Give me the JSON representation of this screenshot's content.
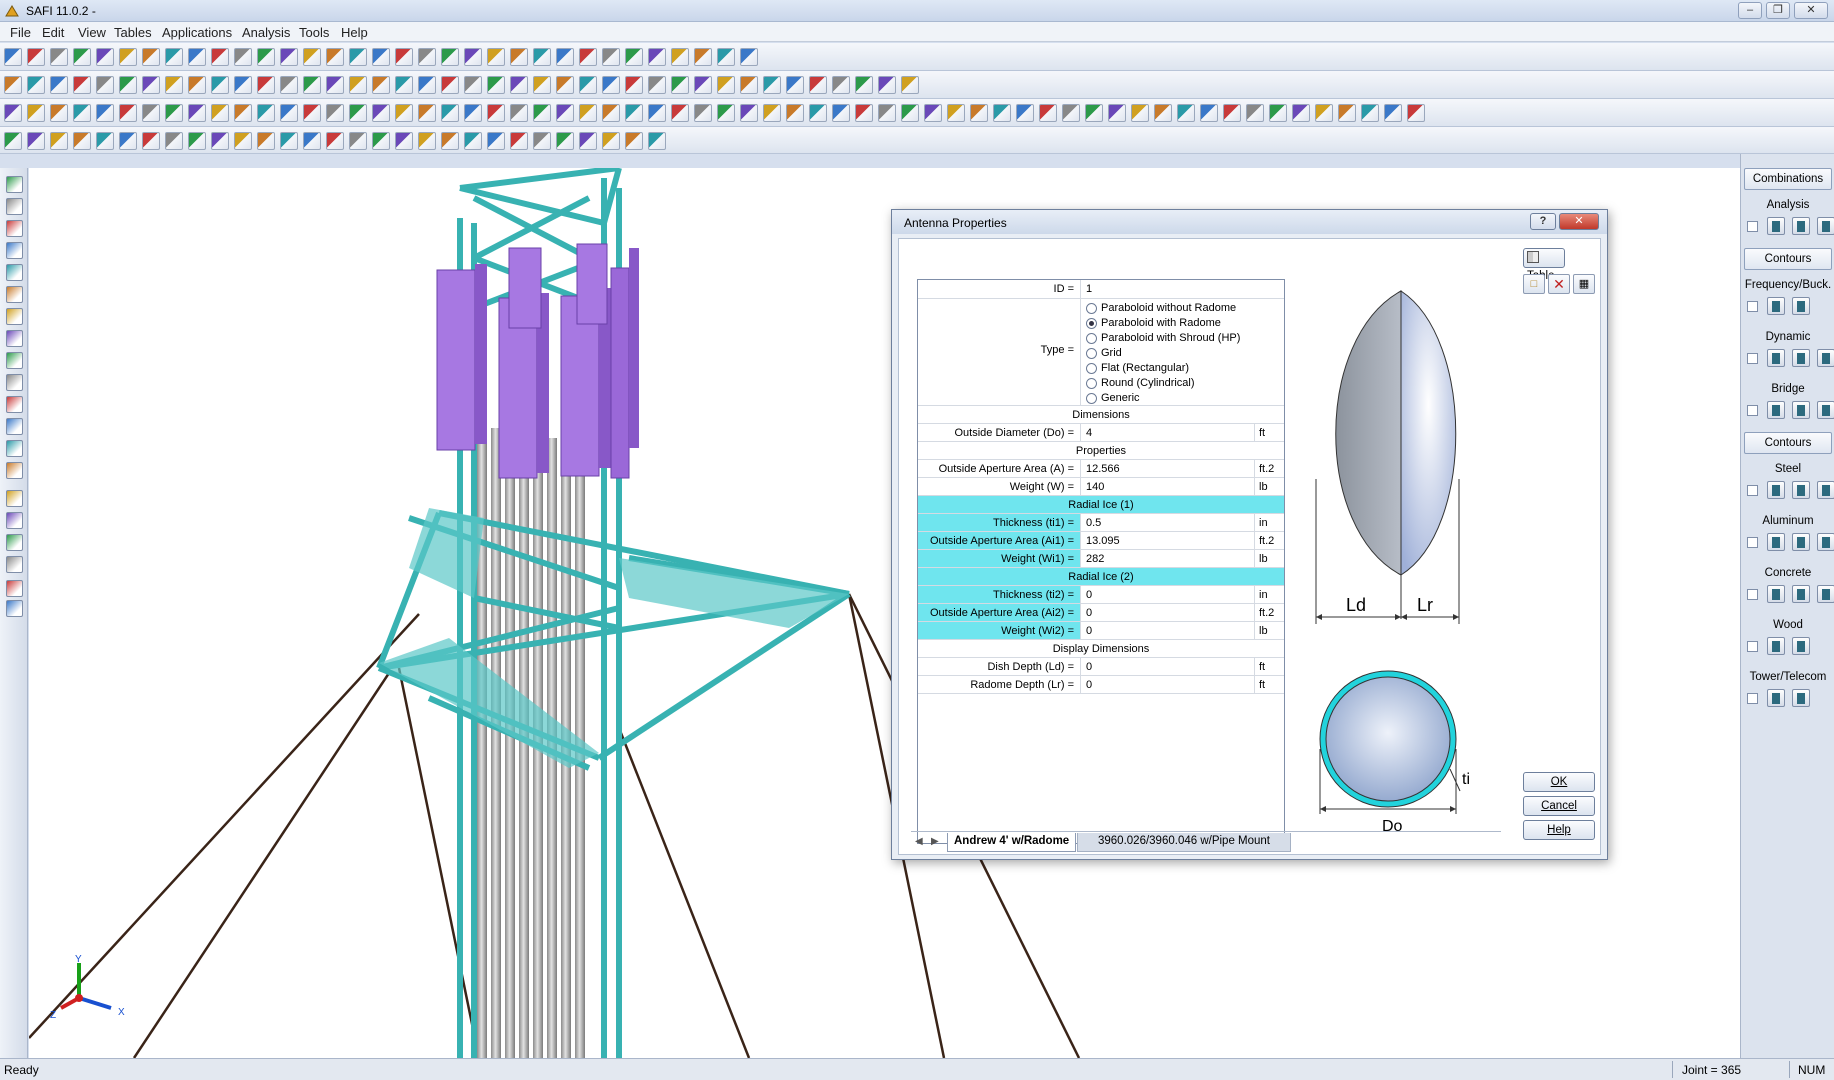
{
  "window": {
    "title": "SAFI 11.0.2 -"
  },
  "menu": [
    "File",
    "Edit",
    "View",
    "Tables",
    "Applications",
    "Analysis",
    "Tools",
    "Help"
  ],
  "right_panel": {
    "items": [
      {
        "type": "button",
        "label": "Combinations"
      },
      {
        "type": "label",
        "label": "Analysis"
      },
      {
        "type": "icons"
      },
      {
        "type": "button",
        "label": "Contours"
      },
      {
        "type": "label",
        "label": "Frequency/Buck."
      },
      {
        "type": "icons2"
      },
      {
        "type": "label",
        "label": "Dynamic"
      },
      {
        "type": "icons"
      },
      {
        "type": "label",
        "label": "Bridge"
      },
      {
        "type": "icons"
      },
      {
        "type": "button",
        "label": "Contours"
      },
      {
        "type": "label",
        "label": "Steel"
      },
      {
        "type": "icons"
      },
      {
        "type": "label",
        "label": "Aluminum"
      },
      {
        "type": "icons"
      },
      {
        "type": "label",
        "label": "Concrete"
      },
      {
        "type": "icons"
      },
      {
        "type": "label",
        "label": "Wood"
      },
      {
        "type": "icons2"
      },
      {
        "type": "label",
        "label": "Tower/Telecom"
      },
      {
        "type": "icons2"
      }
    ]
  },
  "status": {
    "left": "Ready",
    "joint": "Joint = 365",
    "num": "NUM"
  },
  "axis": {
    "x": "X",
    "y": "Y",
    "z": "Z"
  },
  "dialog": {
    "title": "Antenna Properties",
    "help_glyph": "?",
    "close_glyph": "✕",
    "id_label": "ID =",
    "id_value": "1",
    "type_label": "Type =",
    "type_options": [
      {
        "label": "Paraboloid without Radome",
        "selected": false
      },
      {
        "label": "Paraboloid with Radome",
        "selected": true
      },
      {
        "label": "Paraboloid with Shroud (HP)",
        "selected": false
      },
      {
        "label": "Grid",
        "selected": false
      },
      {
        "label": "Flat (Rectangular)",
        "selected": false
      },
      {
        "label": "Round (Cylindrical)",
        "selected": false
      },
      {
        "label": "Generic",
        "selected": false
      }
    ],
    "sections": {
      "dimensions": "Dimensions",
      "properties": "Properties",
      "radial_ice_1": "Radial Ice (1)",
      "radial_ice_2": "Radial Ice (2)",
      "display_dimensions": "Display Dimensions"
    },
    "fields": {
      "outside_diameter": {
        "label": "Outside Diameter (Do) =",
        "value": "4",
        "unit": "ft"
      },
      "aperture_area": {
        "label": "Outside Aperture Area (A) =",
        "value": "12.566",
        "unit": "ft.2"
      },
      "weight": {
        "label": "Weight (W) =",
        "value": "140",
        "unit": "lb"
      },
      "ice1_thickness": {
        "label": "Thickness (ti1) =",
        "value": "0.5",
        "unit": "in"
      },
      "ice1_area": {
        "label": "Outside Aperture Area (Ai1) =",
        "value": "13.095",
        "unit": "ft.2"
      },
      "ice1_weight": {
        "label": "Weight (Wi1) =",
        "value": "282",
        "unit": "lb"
      },
      "ice2_thickness": {
        "label": "Thickness (ti2) =",
        "value": "0",
        "unit": "in"
      },
      "ice2_area": {
        "label": "Outside Aperture Area (Ai2) =",
        "value": "0",
        "unit": "ft.2"
      },
      "ice2_weight": {
        "label": "Weight (Wi2) =",
        "value": "0",
        "unit": "lb"
      },
      "dish_depth": {
        "label": "Dish Depth (Ld) =",
        "value": "0",
        "unit": "ft"
      },
      "radome_depth": {
        "label": "Radome Depth (Lr) =",
        "value": "0",
        "unit": "ft"
      }
    },
    "diagram": {
      "ld": "Ld",
      "lr": "Lr",
      "ti": "ti",
      "do": "Do"
    },
    "buttons": {
      "table": "Table",
      "ok": "OK",
      "cancel": "Cancel",
      "help": "Help"
    },
    "tabs": [
      "Andrew 4' w/Radome",
      "3960.026/3960.046 w/Pipe Mount"
    ]
  }
}
